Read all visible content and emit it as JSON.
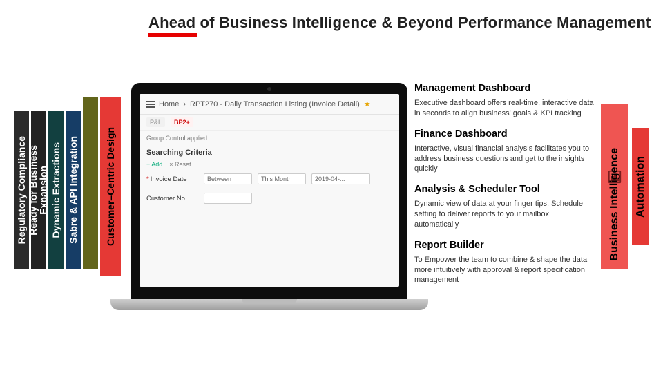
{
  "title": "Ahead of Business Intelligence & Beyond Performance Management",
  "left_tabs": {
    "regulatory": "Regulatory Compliance",
    "ready": "Ready for Business\nExpansion",
    "dynamic": "Dynamic Extractions",
    "sabre": "Sabre & API Integration",
    "ccd": "Customer–Centric Design"
  },
  "right_tabs": {
    "bi": "Business Intelligence",
    "auto": "Automation"
  },
  "screenshot": {
    "home": "Home",
    "sep": "›",
    "report_title": "RPT270 - Daily Transaction Listing (Invoice Detail)",
    "tab_a": "P&L",
    "tab_b": "BP2+",
    "group_control_msg": "Group Control applied.",
    "section": "Searching Criteria",
    "link_add": "+ Add",
    "link_reset": "× Reset",
    "field_invoice": "Invoice Date",
    "field_customer": "Customer No.",
    "op": "Between",
    "range_mode": "This Month",
    "date_value": "2019-04-...",
    "required_mark": "*"
  },
  "sections": {
    "mgmt_h": "Management Dashboard",
    "mgmt_p": "Executive dashboard offers real-time, interactive data in seconds to align business' goals & KPI tracking",
    "fin_h": "Finance Dashboard",
    "fin_p": "Interactive, visual financial analysis facilitates you to address business questions and get to the insights quickly",
    "an_h": "Analysis & Scheduler Tool",
    "an_p": "Dynamic view of data at your finger tips. Schedule setting to deliver reports to your mailbox automatically",
    "rb_h": "Report Builder",
    "rb_p": "To Empower the team to combine & shape the data more intuitively with approval & report specification management"
  }
}
